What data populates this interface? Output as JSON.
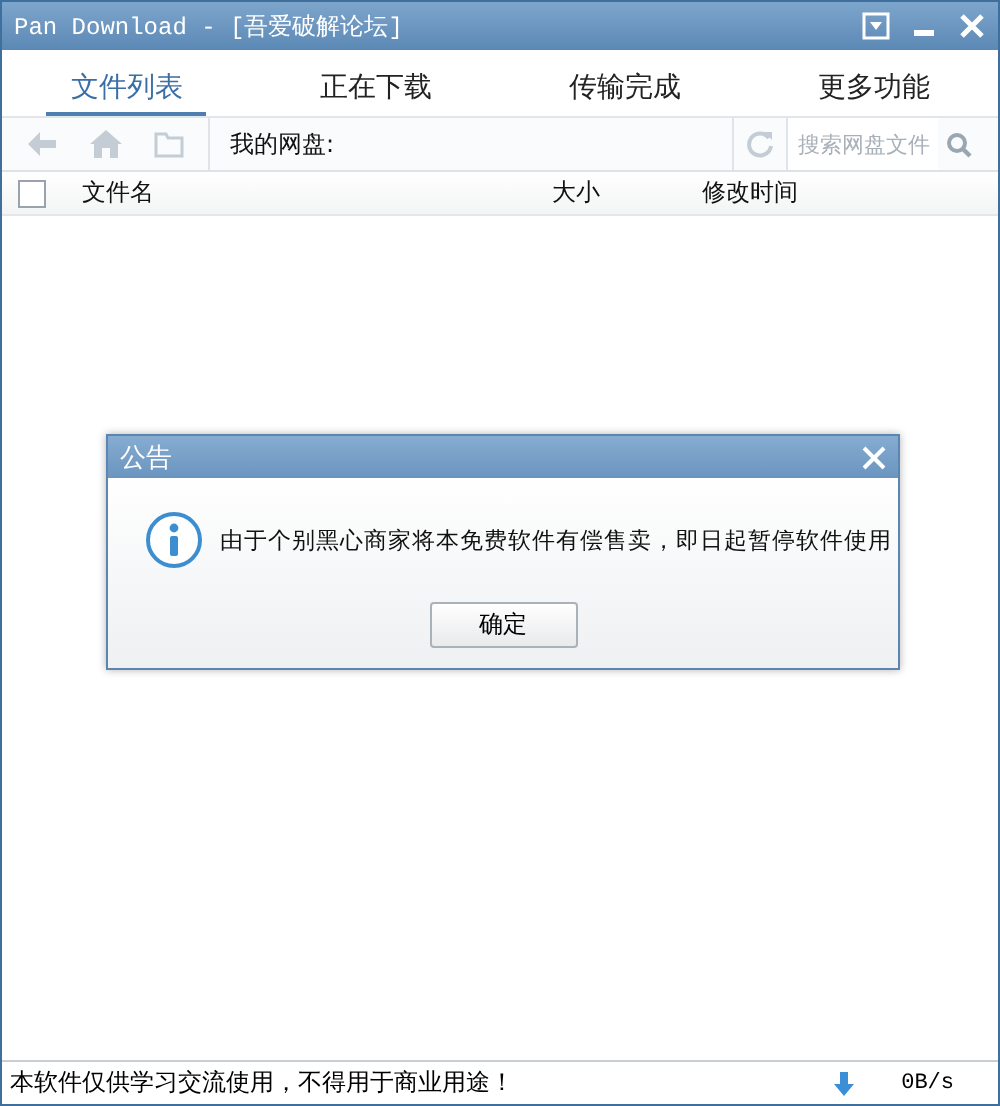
{
  "window": {
    "title": "Pan Download - [吾爱破解论坛]"
  },
  "tabs": [
    {
      "label": "文件列表",
      "selected": true
    },
    {
      "label": "正在下载",
      "selected": false
    },
    {
      "label": "传输完成",
      "selected": false
    },
    {
      "label": "更多功能",
      "selected": false
    }
  ],
  "toolbar": {
    "path_label": "我的网盘:",
    "search": {
      "placeholder": "搜索网盘文件"
    }
  },
  "table": {
    "select_all": {
      "checked": false
    },
    "columns": [
      "文件名",
      "大小",
      "修改时间"
    ]
  },
  "dialog": {
    "title": "公告",
    "message": "由于个别黑心商家将本免费软件有偿售卖，即日起暂停软件使用",
    "button": "确定"
  },
  "status_bar": {
    "text": "本软件仅供学习交流使用，不得用于商业用途！",
    "speed": "0B/s"
  }
}
